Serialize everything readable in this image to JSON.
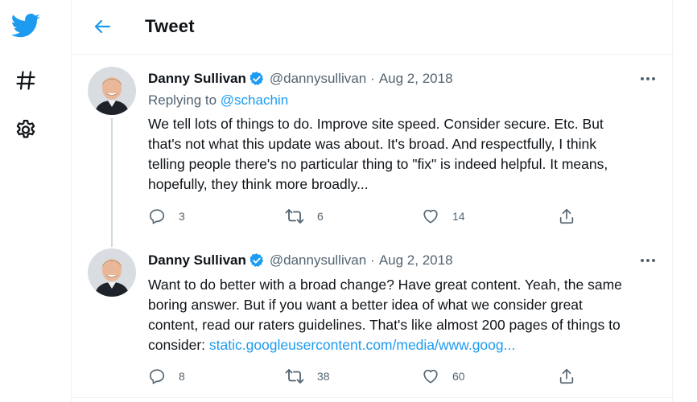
{
  "header": {
    "title": "Tweet"
  },
  "colors": {
    "accent": "#1d9bf0",
    "text": "#0f1419",
    "muted": "#536471"
  },
  "nav": {
    "icons": [
      "twitter-logo-icon",
      "hashtag-icon",
      "gear-icon"
    ]
  },
  "tweets": [
    {
      "author": "Danny Sullivan",
      "handle": "@dannysullivan",
      "separator": "·",
      "date": "Aug 2, 2018",
      "reply_prefix": "Replying to",
      "reply_to": "@schachin",
      "text_lines": [
        "We tell lots of things to do. Improve site speed. Consider secure. Etc. But",
        "that's not what this update was about. It's broad. And respectfully, I think",
        "telling people there's no particular thing to \"fix\" is indeed helpful. It means,",
        "hopefully, they think more broadly..."
      ],
      "stats": {
        "replies": "3",
        "retweets": "6",
        "likes": "14"
      }
    },
    {
      "author": "Danny Sullivan",
      "handle": "@dannysullivan",
      "separator": "·",
      "date": "Aug 2, 2018",
      "text_lines": [
        "Want to do better with a broad change? Have great content. Yeah, the same",
        "boring answer. But if you want a better idea of what we consider great",
        "content, read our raters guidelines. That's like almost 200 pages of things to"
      ],
      "last_line_prefix": "consider: ",
      "link_text": "static.googleusercontent.com/media/www.goog...",
      "stats": {
        "replies": "8",
        "retweets": "38",
        "likes": "60"
      }
    }
  ]
}
